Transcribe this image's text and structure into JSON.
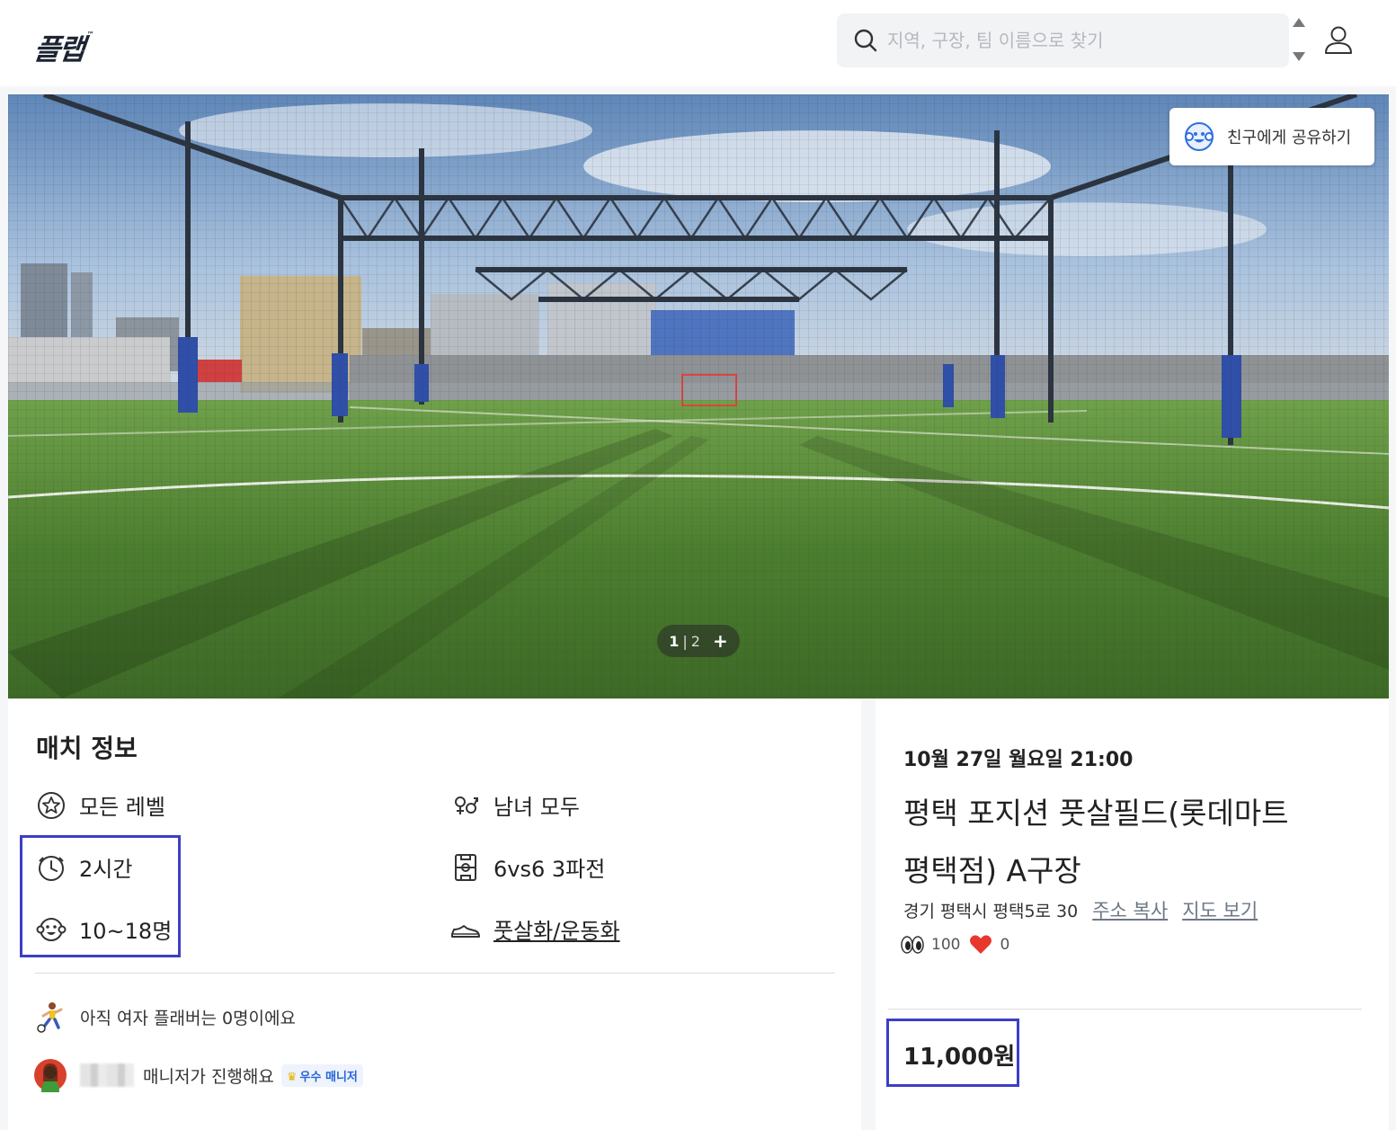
{
  "header": {
    "logo": "플랩",
    "logo_tm": "™",
    "search_placeholder": "지역, 구장, 팀 이름으로 찾기"
  },
  "hero": {
    "share_label": "친구에게 공유하기",
    "pager_current": "1",
    "pager_separator": "|",
    "pager_total": "2",
    "pager_plus": "+"
  },
  "match_info": {
    "heading": "매치 정보",
    "features": {
      "level": "모든 레벨",
      "gender": "남녀 모두",
      "duration": "2시간",
      "format": "6vs6 3파전",
      "players": "10~18명",
      "shoes": "풋살화/운동화"
    },
    "female_note": "아직 여자 플래버는 0명이에요",
    "manager_note": "매니저가 진행해요",
    "manager_badge": "우수 매니저"
  },
  "match_card": {
    "datetime": "10월 27일 월요일 21:00",
    "title_line1": "평택 포지션 풋살필드(롯데마트",
    "title_line2": "평택점) A구장",
    "address": "경기 평택시 평택5로 30",
    "copy_address": "주소 복사",
    "view_map": "지도 보기",
    "views": "100",
    "likes": "0",
    "price": "11,000원"
  },
  "colors": {
    "highlight": "#3d3ec6",
    "heart": "#e8382e",
    "link": "#6d7786"
  }
}
